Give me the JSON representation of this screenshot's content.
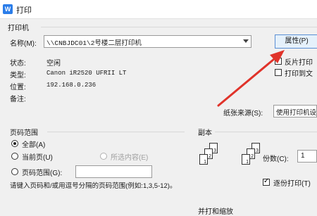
{
  "window": {
    "title": "打印",
    "app_icon_letter": "W"
  },
  "printer": {
    "group_title": "打印机",
    "name_label": "名称(M):",
    "name_value": "\\\\CNBJDC01\\2号楼二层打印机",
    "properties_button": "属性(P)",
    "status_label": "状态:",
    "status_value": "空闲",
    "type_label": "类型:",
    "type_value": "Canon iR2520 UFRII LT",
    "location_label": "位置:",
    "location_value": "192.168.0.236",
    "comment_label": "备注:",
    "reverse_print_label": "反片打印",
    "print_to_file_label": "打印到文",
    "paper_source_label": "纸张来源(S):",
    "paper_source_value": "使用打印机设"
  },
  "page_range": {
    "group_title": "页码范围",
    "all_label": "全部(A)",
    "current_label": "当前页(U)",
    "selection_label": "所选内容(E)",
    "range_label": "页码范围(G):",
    "range_value": "",
    "hint": "请键入页码和/或用逗号分隔的页码范围(例如:1,3,5-12)。"
  },
  "copies": {
    "group_title": "副本",
    "count_label": "份数(C):",
    "count_value": "1",
    "collate_label": "逐份打印(T)",
    "collate_checked": true
  },
  "bottom": {
    "zoom_partial": "并打和缩放"
  },
  "colors": {
    "arrow": "#e0332a",
    "app_icon": "#2b7de9"
  }
}
